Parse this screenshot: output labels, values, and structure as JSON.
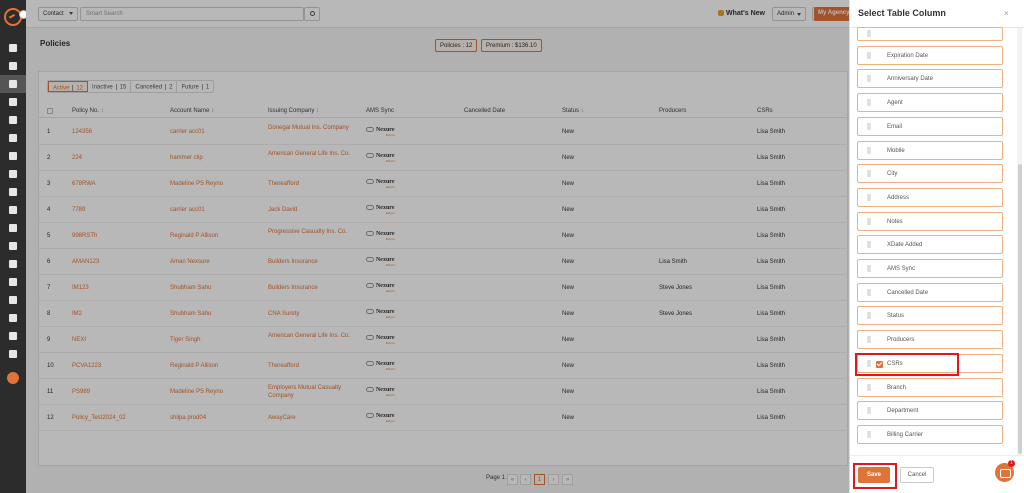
{
  "topbar": {
    "entity_select": "Contact",
    "search_placeholder": "Smart Search",
    "whats_new": "What's New",
    "user_select": "Admin",
    "agency_button": "My Agency"
  },
  "page": {
    "title": "Policies",
    "stat_policies": "Policies : 12",
    "stat_premium": "Premium : $136.10"
  },
  "status_tabs": [
    {
      "label": "Active",
      "count": "12"
    },
    {
      "label": "Inactive",
      "count": "15"
    },
    {
      "label": "Cancelled",
      "count": "2"
    },
    {
      "label": "Future",
      "count": "1"
    }
  ],
  "table": {
    "headers": [
      "Policy No.",
      "Account Name",
      "Issuing Company",
      "AMS Sync",
      "Cancelled Date",
      "Status",
      "Producers",
      "CSRs"
    ],
    "ams_logo_text": "Nexure",
    "ams_logo_sub": "Ezlynx",
    "rows": [
      {
        "n": "1",
        "policy": "124356",
        "account": "carrier acc01",
        "company": "Donegal Mutual Ins. Company",
        "status": "New",
        "producer": "",
        "csr": "Lisa Smith"
      },
      {
        "n": "2",
        "policy": "224",
        "account": "hammer clip",
        "company": "American General Life Ins. Co.",
        "status": "New",
        "producer": "",
        "csr": "Lisa Smith"
      },
      {
        "n": "3",
        "policy": "678RWA",
        "account": "Madeline PS Reyno",
        "company": "Thereafford",
        "status": "New",
        "producer": "",
        "csr": "Lisa Smith"
      },
      {
        "n": "4",
        "policy": "7789",
        "account": "carrier acc01",
        "company": "Jack David",
        "status": "New",
        "producer": "",
        "csr": "Lisa Smith"
      },
      {
        "n": "5",
        "policy": "998RSTh",
        "account": "Reginald P Allison",
        "company": "Progressive Casualty Ins. Co.",
        "status": "New",
        "producer": "",
        "csr": "Lisa Smith"
      },
      {
        "n": "6",
        "policy": "AMAN123",
        "account": "Aman Nexsure",
        "company": "Builders Insurance",
        "status": "New",
        "producer": "Lisa Smith",
        "csr": "Lisa Smith"
      },
      {
        "n": "7",
        "policy": "IM123",
        "account": "Shubham Sahu",
        "company": "Builders Insurance",
        "status": "New",
        "producer": "Steve Jones",
        "csr": "Lisa Smith"
      },
      {
        "n": "8",
        "policy": "IM2",
        "account": "Shubham Sahu",
        "company": "CNA Surety",
        "status": "New",
        "producer": "Steve Jones",
        "csr": "Lisa Smith"
      },
      {
        "n": "9",
        "policy": "NEXI",
        "account": "Tiger Singh",
        "company": "American General Life Ins. Co.",
        "status": "New",
        "producer": "",
        "csr": "Lisa Smith"
      },
      {
        "n": "10",
        "policy": "PCVA1223",
        "account": "Reginald P Allison",
        "company": "Thereafford",
        "status": "New",
        "producer": "",
        "csr": "Lisa Smith"
      },
      {
        "n": "11",
        "policy": "PS989",
        "account": "Madeline PS Reyno",
        "company": "Employers Mutual Casualty Company",
        "status": "New",
        "producer": "",
        "csr": "Lisa Smith"
      },
      {
        "n": "12",
        "policy": "Policy_Test2024_02",
        "account": "shilpa prod04",
        "company": "AwayCare",
        "status": "New",
        "producer": "",
        "csr": "Lisa Smith"
      }
    ]
  },
  "pagination": {
    "label": "Page 1 / 1",
    "current": "1",
    "first": "«",
    "prev": "‹",
    "next": "›",
    "last": "»"
  },
  "drawer": {
    "title": "Select Table Column",
    "close": "×",
    "columns": [
      {
        "label": "",
        "checked": false
      },
      {
        "label": "Expiration Date",
        "checked": false
      },
      {
        "label": "Anniversary Date",
        "checked": false
      },
      {
        "label": "Agent",
        "checked": false
      },
      {
        "label": "Email",
        "checked": false
      },
      {
        "label": "Mobile",
        "checked": false
      },
      {
        "label": "City",
        "checked": false
      },
      {
        "label": "Address",
        "checked": false
      },
      {
        "label": "Notes",
        "checked": false
      },
      {
        "label": "XDate Added",
        "checked": false
      },
      {
        "label": "AMS Sync",
        "checked": false
      },
      {
        "label": "Cancelled Date",
        "checked": false
      },
      {
        "label": "Status",
        "checked": false
      },
      {
        "label": "Producers",
        "checked": false
      },
      {
        "label": "CSRs",
        "checked": true
      },
      {
        "label": "Branch",
        "checked": false
      },
      {
        "label": "Department",
        "checked": false
      },
      {
        "label": "Billing Carrier",
        "checked": false
      }
    ],
    "save": "Save",
    "cancel": "Cancel",
    "chat_badge": "1"
  },
  "colors": {
    "accent": "#e0733a",
    "highlight": "#e0181b",
    "nav_bg": "#2c2c2c"
  }
}
